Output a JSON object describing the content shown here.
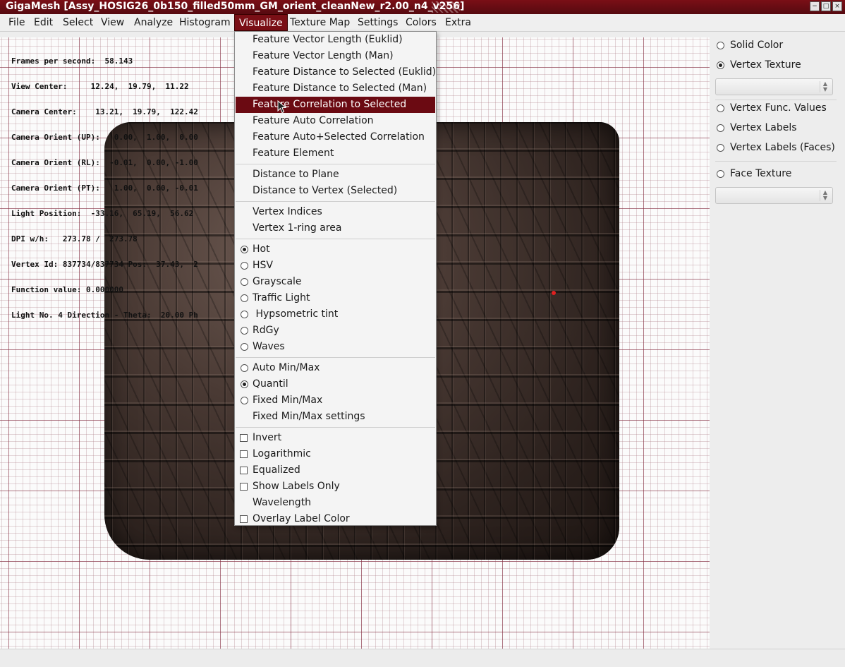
{
  "window": {
    "title": "GigaMesh [Assy_HOSIG26_0b150_filled50mm_GM_orient_cleanNew_r2.00_n4_v256]",
    "controls": [
      "−",
      "□",
      "×"
    ]
  },
  "menubar": {
    "items": [
      "File",
      "Edit",
      "Select",
      "View",
      "Analyze",
      "Histogram",
      "Visualize",
      "Texture Map",
      "Settings",
      "Colors",
      "Extra"
    ],
    "active": "Visualize"
  },
  "hud": {
    "lines": [
      "Frames per second:  58.143",
      "View Center:     12.24,  19.79,  11.22",
      "Camera Center:    13.21,  19.79,  122.42",
      "Camera Orient (UP):   0.00,  1.00,  0.00",
      "Camera Orient (RL):  -0.01,  0.00, -1.00",
      "Camera Orient (PT):   1.00,  0.00, -0.01",
      "Light Position:  -33.16,  65.19,  56.62",
      "DPI w/h:   273.78 /  273.78",
      "Vertex Id: 837734/837734 Pos:  37.43,  2",
      "Function value: 0.000000",
      "Light No. 4 Direction - Theta:  20.00 Ph"
    ]
  },
  "visualize_menu": {
    "group_feature": [
      "Feature Vector Length (Euklid)",
      "Feature Vector Length (Man)",
      "Feature Distance to Selected (Euklid)",
      "Feature Distance to Selected (Man)",
      "Feature Correlation to Selected",
      "Feature Auto Correlation",
      "Feature Auto+Selected Correlation",
      "Feature Element"
    ],
    "highlighted": "Feature Correlation to Selected",
    "group_distance": [
      "Distance to Plane",
      "Distance to Vertex (Selected)"
    ],
    "group_vertex": [
      "Vertex Indices",
      "Vertex 1-ring area"
    ],
    "colormaps": [
      "Hot",
      "HSV",
      "Grayscale",
      "Traffic Light",
      " Hypsometric tint",
      "RdGy",
      "Waves"
    ],
    "colormap_selected": "Hot",
    "range_modes": [
      "Auto Min/Max",
      "Quantil",
      "Fixed Min/Max"
    ],
    "range_selected": "Quantil",
    "range_settings": "Fixed Min/Max settings",
    "options_checks": [
      "Invert",
      "Logarithmic",
      "Equalized",
      "Show Labels Only"
    ],
    "wavelength": "Wavelength",
    "overlay": "Overlay Label Color"
  },
  "sidepanel": {
    "solid_color": "Solid Color",
    "vertex_texture": "Vertex Texture",
    "vertex_func_values": "Vertex Func. Values",
    "vertex_labels": "Vertex Labels",
    "vertex_labels_faces": "Vertex Labels (Faces)",
    "face_texture": "Face Texture",
    "selected": "Vertex Texture"
  }
}
